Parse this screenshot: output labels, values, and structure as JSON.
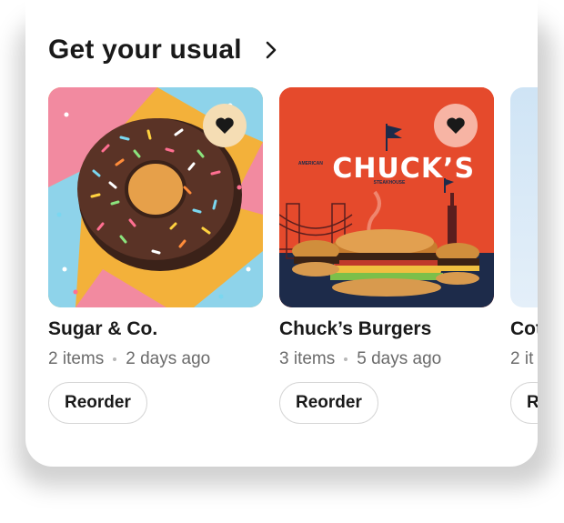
{
  "section": {
    "title": "Get your usual"
  },
  "stores": [
    {
      "name": "Sugar & Co.",
      "items": "2 items",
      "last_order": "2 days ago",
      "button_label": "Reorder"
    },
    {
      "name": "Chuck’s Burgers",
      "items": "3 items",
      "last_order": "5 days ago",
      "button_label": "Reorder",
      "logo_text": "CHUCK’S",
      "logo_left": "AMERICAN",
      "logo_right": "STEAKHOUSE"
    },
    {
      "name": "Cot",
      "items": "2 it",
      "last_order": "",
      "button_label": "R"
    }
  ],
  "icons": {
    "chevron": "chevron-right-icon",
    "favorite": "heart-icon"
  },
  "colors": {
    "text": "#191919",
    "secondary": "#6b6b6b",
    "chucks_bg": "#e54a2c"
  }
}
